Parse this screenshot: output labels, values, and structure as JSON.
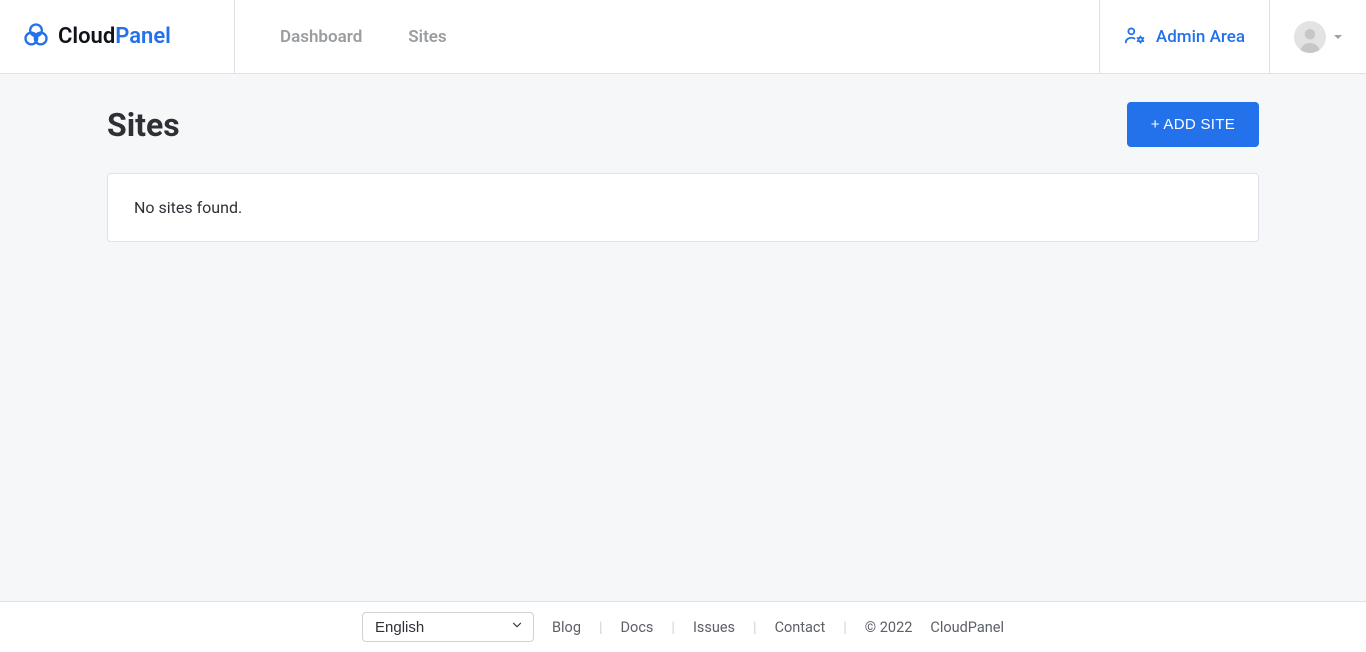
{
  "brand": {
    "part1": "Cloud",
    "part2": "Panel"
  },
  "nav": {
    "dashboard": "Dashboard",
    "sites": "Sites"
  },
  "header": {
    "admin_area": "Admin Area"
  },
  "page": {
    "title": "Sites",
    "add_site_button": "+ ADD SITE",
    "empty_message": "No sites found."
  },
  "footer": {
    "language_selected": "English",
    "links": {
      "blog": "Blog",
      "docs": "Docs",
      "issues": "Issues",
      "contact": "Contact"
    },
    "copyright": "© 2022",
    "product": "CloudPanel"
  }
}
